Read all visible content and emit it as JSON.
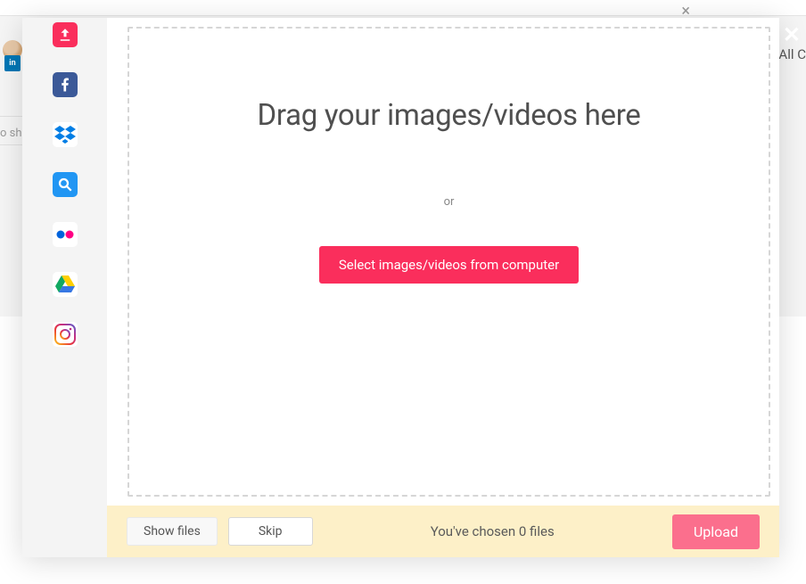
{
  "backdrop": {
    "linkedin_badge": "in",
    "right_text": "All C",
    "left_text": "o sh"
  },
  "sidebar": {
    "sources": [
      {
        "name": "upload-icon",
        "label": "Upload"
      },
      {
        "name": "facebook-icon",
        "label": "Facebook"
      },
      {
        "name": "dropbox-icon",
        "label": "Dropbox"
      },
      {
        "name": "search-icon",
        "label": "Search"
      },
      {
        "name": "flickr-icon",
        "label": "Flickr"
      },
      {
        "name": "google-drive-icon",
        "label": "Google Drive"
      },
      {
        "name": "instagram-icon",
        "label": "Instagram"
      }
    ]
  },
  "dropzone": {
    "heading": "Drag your images/videos here",
    "or_text": "or",
    "select_label": "Select images/videos from computer"
  },
  "footer": {
    "show_files_label": "Show files",
    "skip_label": "Skip",
    "status_prefix": "You've chosen ",
    "file_count": 0,
    "status_suffix": " files",
    "upload_label": "Upload"
  },
  "colors": {
    "primary": "#fa2e5c",
    "footer_bg": "#fdf0c8"
  }
}
